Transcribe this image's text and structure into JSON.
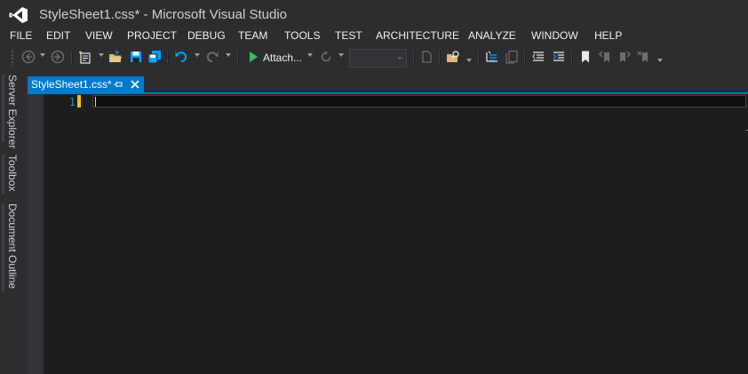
{
  "window": {
    "title": "StyleSheet1.css* - Microsoft Visual Studio"
  },
  "menu": {
    "items": [
      "FILE",
      "EDIT",
      "VIEW",
      "PROJECT",
      "DEBUG",
      "TEAM",
      "TOOLS",
      "TEST",
      "ARCHITECTURE",
      "ANALYZE",
      "WINDOW",
      "HELP"
    ]
  },
  "toolbar": {
    "attach_label": "Attach...",
    "solution_config_value": "",
    "icons": [
      "back-icon",
      "forward-icon",
      "new-project-icon",
      "open-file-icon",
      "save-icon",
      "save-all-icon",
      "undo-icon",
      "redo-icon",
      "start-icon",
      "refresh-icon",
      "find-icon",
      "comment-icon",
      "uncomment-icon",
      "outdent-icon",
      "indent-icon",
      "bookmark-icon",
      "prev-bookmark-icon",
      "next-bookmark-icon",
      "clear-bookmarks-icon"
    ]
  },
  "side_tabs": [
    "Server Explorer",
    "Toolbox",
    "Document Outline"
  ],
  "document_tab": {
    "label": "StyleSheet1.css*",
    "pin_icon": "pin-icon",
    "close_icon": "close-icon"
  },
  "editor": {
    "line_numbers": [
      "1"
    ],
    "content": ""
  },
  "colors": {
    "accent": "#007acc",
    "chrome": "#2d2d30",
    "editor_bg": "#1e1e1e",
    "line_number": "#2b91af",
    "change_marker": "#efc018"
  }
}
